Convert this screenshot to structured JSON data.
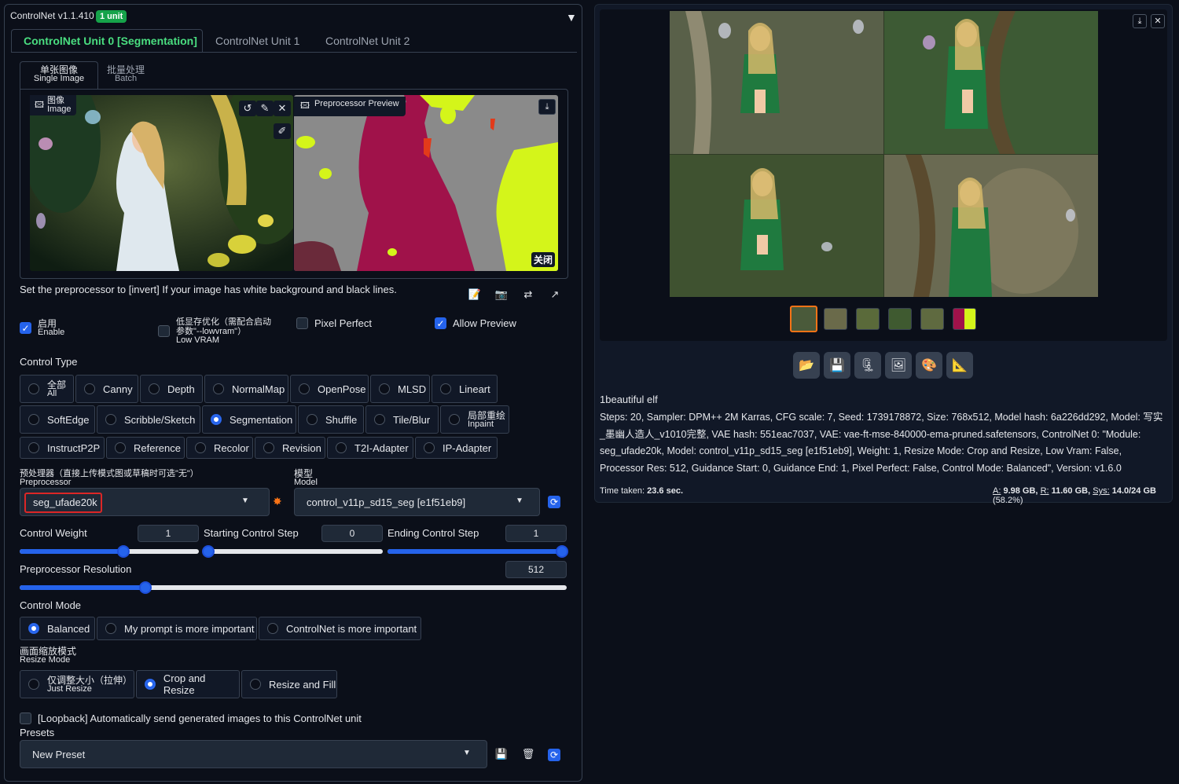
{
  "header": {
    "title": "ControlNet v1.1.410",
    "badge": "1 unit"
  },
  "tabs": [
    {
      "label": "ControlNet Unit 0 [Segmentation]"
    },
    {
      "label": "ControlNet Unit 1"
    },
    {
      "label": "ControlNet Unit 2"
    }
  ],
  "subtabs": [
    {
      "zh": "单张图像",
      "en": "Single Image"
    },
    {
      "zh": "批量处理",
      "en": "Batch"
    }
  ],
  "image_panel": {
    "zh": "图像",
    "en": "Image"
  },
  "preview_panel": {
    "label": "Preprocessor Preview",
    "close_label": "关闭"
  },
  "hint": "Set the preprocessor to [invert] If your image has white background and black lines.",
  "options": {
    "enable": {
      "zh": "启用",
      "en": "Enable",
      "checked": true
    },
    "lowvram": {
      "zh": "低显存优化（需配合启动参数\"--lowvram\"）",
      "en": "Low VRAM",
      "checked": false
    },
    "pixel_perfect": {
      "label": "Pixel Perfect",
      "checked": false
    },
    "allow_preview": {
      "label": "Allow Preview",
      "checked": true
    }
  },
  "control_type": {
    "label": "Control Type",
    "selected": "Segmentation",
    "items": [
      {
        "zh": "全部",
        "en": "All"
      },
      {
        "label": "Canny"
      },
      {
        "label": "Depth"
      },
      {
        "label": "NormalMap"
      },
      {
        "label": "OpenPose"
      },
      {
        "label": "MLSD"
      },
      {
        "label": "Lineart"
      },
      {
        "label": "SoftEdge"
      },
      {
        "label": "Scribble/Sketch"
      },
      {
        "label": "Segmentation"
      },
      {
        "label": "Shuffle"
      },
      {
        "label": "Tile/Blur"
      },
      {
        "zh": "局部重绘",
        "en": "Inpaint"
      },
      {
        "label": "InstructP2P"
      },
      {
        "label": "Reference"
      },
      {
        "label": "Recolor"
      },
      {
        "label": "Revision"
      },
      {
        "label": "T2I-Adapter"
      },
      {
        "label": "IP-Adapter"
      }
    ]
  },
  "preprocessor": {
    "zh": "预处理器（直接上传模式图或草稿时可选\"无\"）",
    "en": "Preprocessor",
    "value": "seg_ufade20k"
  },
  "model": {
    "zh": "模型",
    "en": "Model",
    "value": "control_v11p_sd15_seg [e1f51eb9]"
  },
  "control_weight": {
    "label": "Control Weight",
    "value": "1",
    "level": 0.58
  },
  "starting_step": {
    "label": "Starting Control Step",
    "value": "0",
    "level": 0
  },
  "ending_step": {
    "label": "Ending Control Step",
    "value": "1",
    "level": 1
  },
  "preproc_res": {
    "label": "Preprocessor Resolution",
    "value": "512",
    "level": 0.23
  },
  "control_mode": {
    "label": "Control Mode",
    "items": [
      "Balanced",
      "My prompt is more important",
      "ControlNet is more important"
    ],
    "selected": "Balanced"
  },
  "resize_mode": {
    "zh": "画面缩放模式",
    "en": "Resize Mode",
    "items": [
      {
        "zh": "仅调整大小（拉伸）",
        "en": "Just Resize"
      },
      {
        "label": "Crop and Resize"
      },
      {
        "label": "Resize and Fill"
      }
    ],
    "selected": "Crop and Resize"
  },
  "loopback": {
    "label": "[Loopback] Automatically send generated images to this ControlNet unit",
    "checked": false
  },
  "presets": {
    "label": "Presets",
    "value": "New Preset"
  },
  "output": {
    "prompt": "1beautiful elf",
    "params": "Steps: 20, Sampler: DPM++ 2M Karras, CFG scale: 7, Seed: 1739178872, Size: 768x512, Model hash: 6a226dd292, Model: 写实_墨幽人造人_v1010完整, VAE hash: 551eac7037, VAE: vae-ft-mse-840000-ema-pruned.safetensors, ControlNet 0: \"Module: seg_ufade20k, Model: control_v11p_sd15_seg [e1f51eb9], Weight: 1, Resize Mode: Crop and Resize, Low Vram: False, Processor Res: 512, Guidance Start: 0, Guidance End: 1, Pixel Perfect: False, Control Mode: Balanced\", Version: v1.6.0",
    "time_label": "Time taken:",
    "time_value": "23.6 sec.",
    "mem_a_label": "A:",
    "mem_a": "9.98 GB,",
    "mem_r_label": "R:",
    "mem_r": "11.60 GB,",
    "mem_sys_label": "Sys:",
    "mem_sys": "14.0/24 GB",
    "mem_pct": "(58.2%)"
  },
  "colors": {
    "accent": "#2563eb",
    "tab_active": "#4ade80",
    "badge": "#16a34a",
    "seg_crimson": "#a0124a",
    "seg_gray": "#8a8a8a",
    "seg_lime": "#d4f51a"
  }
}
